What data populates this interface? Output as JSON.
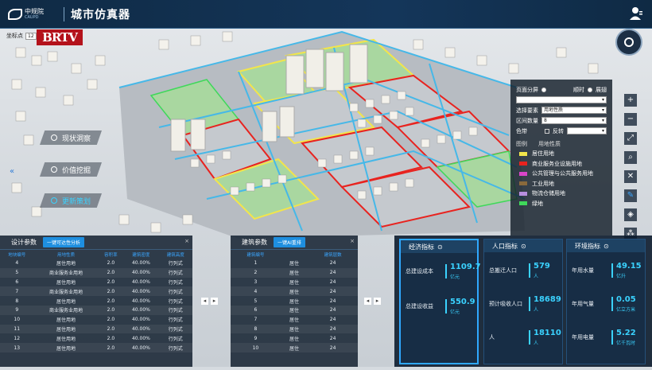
{
  "header": {
    "logo_text": "中规院",
    "logo_sub": "CAUPD",
    "title": "城市仿真器"
  },
  "coord": {
    "label": "坐标点",
    "value": "12"
  },
  "watermark": "BRTV",
  "nav": [
    {
      "label": "现状洞察",
      "active": false
    },
    {
      "label": "价值挖掘",
      "active": false
    },
    {
      "label": "更新策划",
      "active": true
    }
  ],
  "layer_panel": {
    "split_label": "页面分屏",
    "opt1": "顺时",
    "opt2": "展翅",
    "select_label": "选择要素",
    "select_value": "用地性质",
    "interval_label": "区间数量",
    "interval_value": "8",
    "colorband_label": "色带",
    "reverse_label": "反转",
    "legend_head": {
      "a": "图例",
      "b": "用地性质"
    },
    "legend": [
      {
        "label": "居住用地",
        "color": "#f2e54b"
      },
      {
        "label": "商业服务业设施用地",
        "color": "#e8231f"
      },
      {
        "label": "公共管理与公共服务用地",
        "color": "#d945c8"
      },
      {
        "label": "工业用地",
        "color": "#8a6a3c"
      },
      {
        "label": "物流仓储用地",
        "color": "#b88fe0"
      },
      {
        "label": "绿地",
        "color": "#3fd85a"
      }
    ]
  },
  "design_panel": {
    "title": "设计参数",
    "button": "一键可达性分析",
    "cols": [
      "地块编号",
      "用地性质",
      "容积率",
      "建筑密度",
      "建筑高度"
    ],
    "rows": [
      [
        "4",
        "居住用地",
        "2.0",
        "40.00%",
        "行列式"
      ],
      [
        "5",
        "商业服务业用地",
        "2.0",
        "40.00%",
        "行列式"
      ],
      [
        "6",
        "居住用地",
        "2.0",
        "40.00%",
        "行列式"
      ],
      [
        "7",
        "商业服务业用地",
        "2.0",
        "40.00%",
        "行列式"
      ],
      [
        "8",
        "居住用地",
        "2.0",
        "40.00%",
        "行列式"
      ],
      [
        "9",
        "商业服务业用地",
        "2.0",
        "40.00%",
        "行列式"
      ],
      [
        "10",
        "居住用地",
        "2.0",
        "40.00%",
        "行列式"
      ],
      [
        "11",
        "居住用地",
        "2.0",
        "40.00%",
        "行列式"
      ],
      [
        "12",
        "居住用地",
        "2.0",
        "40.00%",
        "行列式"
      ],
      [
        "13",
        "居住用地",
        "2.0",
        "40.00%",
        "行列式"
      ]
    ]
  },
  "building_panel": {
    "title": "建筑参数",
    "button": "一键AI重排",
    "cols": [
      "建筑编号",
      "",
      "",
      "建筑层数"
    ],
    "rows": [
      [
        "1",
        "居住",
        "24"
      ],
      [
        "2",
        "居住",
        "24"
      ],
      [
        "3",
        "居住",
        "24"
      ],
      [
        "4",
        "居住",
        "24"
      ],
      [
        "5",
        "居住",
        "24"
      ],
      [
        "6",
        "居住",
        "24"
      ],
      [
        "7",
        "居住",
        "24"
      ],
      [
        "8",
        "居住",
        "24"
      ],
      [
        "9",
        "居住",
        "24"
      ],
      [
        "10",
        "居住",
        "24"
      ]
    ]
  },
  "indicators": [
    {
      "title": "经济指标",
      "rows": [
        {
          "label": "总建设成本",
          "value": "1109.7",
          "unit": "亿元"
        },
        {
          "label": "总建设收益",
          "value": "550.9",
          "unit": "亿元"
        }
      ]
    },
    {
      "title": "人口指标",
      "rows": [
        {
          "label": "总搬迁人口",
          "value": "579",
          "unit": "人"
        },
        {
          "label": "预计吸收人口",
          "value": "18689",
          "unit": "人"
        },
        {
          "label": "人",
          "value": "18110",
          "unit": "人"
        }
      ]
    },
    {
      "title": "环境指标",
      "rows": [
        {
          "label": "年用水量",
          "value": "49.15",
          "unit": "亿升"
        },
        {
          "label": "年用气量",
          "value": "0.05",
          "unit": "亿立方米"
        },
        {
          "label": "年用电量",
          "value": "5.22",
          "unit": "亿千瓦时"
        }
      ]
    }
  ]
}
